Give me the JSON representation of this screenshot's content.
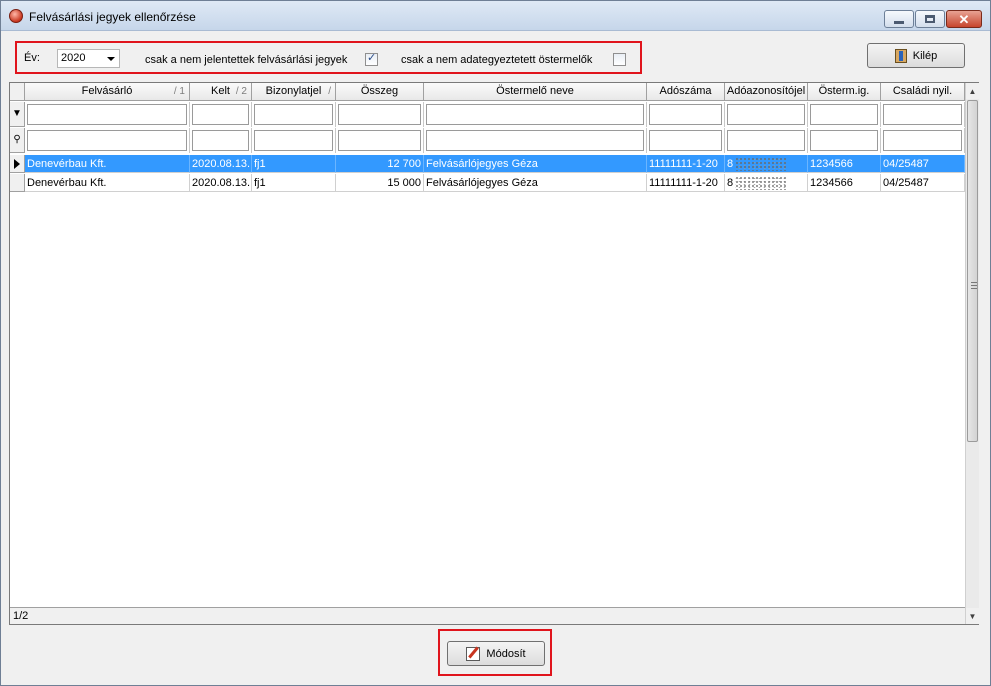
{
  "window": {
    "title": "Felvásárlási jegyek ellenőrzése"
  },
  "filters": {
    "year_label": "Év:",
    "year_value": "2020",
    "only_unreported_label": "csak a nem jelentettek felvásárlási jegyek",
    "only_unreported_checked": true,
    "only_unmatched_label": "csak a nem adategyeztetett östermelők",
    "only_unmatched_checked": false
  },
  "buttons": {
    "exit_label": "Kilép",
    "modify_label": "Módosít"
  },
  "grid": {
    "columns": [
      {
        "label": "Felvásárló",
        "sort": "/ 1"
      },
      {
        "label": "Kelt",
        "sort": "/ 2"
      },
      {
        "label": "Bizonylatjel",
        "sort": "/"
      },
      {
        "label": "Összeg",
        "sort": ""
      },
      {
        "label": "Östermelő neve",
        "sort": ""
      },
      {
        "label": "Adószáma",
        "sort": ""
      },
      {
        "label": "Adóazonosítójel",
        "sort": ""
      },
      {
        "label": "Österm.ig.",
        "sort": ""
      },
      {
        "label": "Családi nyil.",
        "sort": ""
      }
    ],
    "rows": [
      {
        "selected": true,
        "cells": [
          "Denevérbau Kft.",
          "2020.08.13.",
          "fj1",
          "12 700",
          "Felvásárlójegyes Géza",
          "11111111-1-20",
          "8",
          "1234566",
          "04/25487"
        ]
      },
      {
        "selected": false,
        "cells": [
          "Denevérbau Kft.",
          "2020.08.13.",
          "fj1",
          "15 000",
          "Felvásárlójegyes Géza",
          "11111111-1-20",
          "8",
          "1234566",
          "04/25487"
        ]
      }
    ],
    "status": "1/2"
  },
  "colors": {
    "highlight_border": "#e0141c",
    "selected_row": "#3399ff"
  }
}
